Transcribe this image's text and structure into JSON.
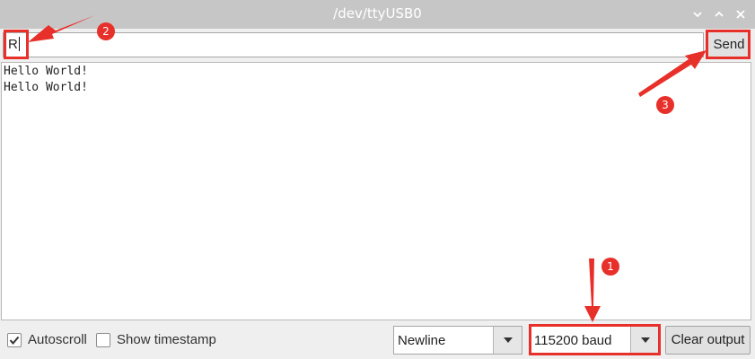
{
  "window": {
    "title": "/dev/ttyUSB0",
    "controls": [
      "chevron-down-icon",
      "chevron-up-icon",
      "close-icon"
    ]
  },
  "input": {
    "value": "R"
  },
  "send_label": "Send",
  "output_lines": [
    "Hello World!",
    "Hello World!"
  ],
  "status": {
    "autoscroll": {
      "label": "Autoscroll",
      "checked": true
    },
    "timestamp": {
      "label": "Show timestamp",
      "checked": false
    },
    "line_ending": "Newline",
    "baud_rate": "115200 baud",
    "clear_label": "Clear output"
  },
  "annotations": {
    "marker_1": "1",
    "marker_2": "2",
    "marker_3": "3"
  },
  "colors": {
    "annotation": "#e8302a",
    "titlebar": "#c6c6c6"
  }
}
